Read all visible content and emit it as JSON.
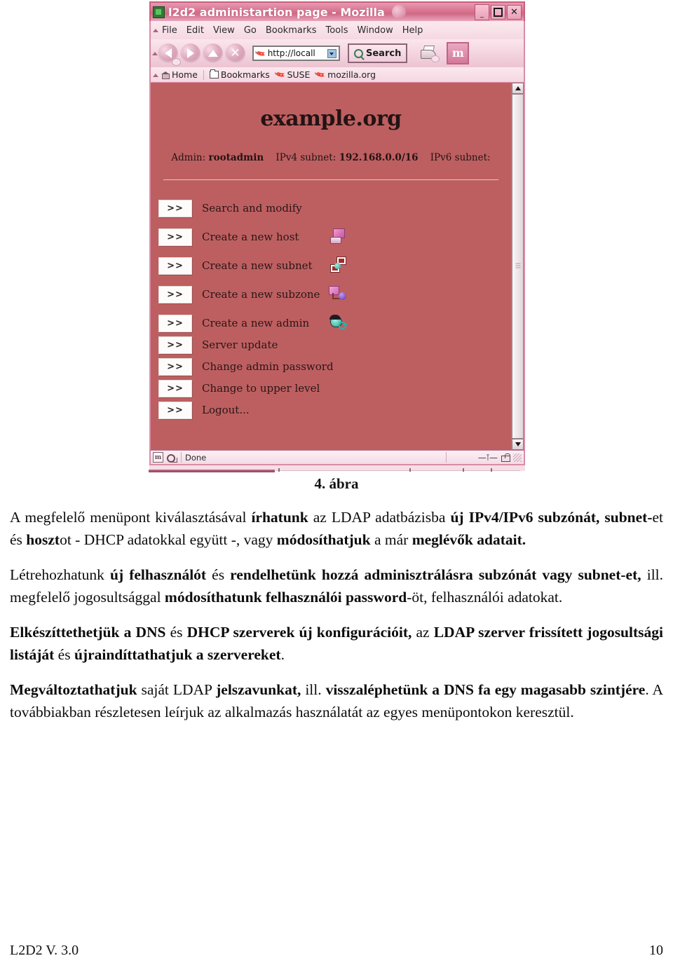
{
  "figure": {
    "browser": {
      "title": "l2d2 administartion page - Mozilla",
      "title_icon": "mozilla-document-icon",
      "throbber": "throbber-icon",
      "window_buttons": [
        {
          "name": "minimize-button",
          "glyph": "_"
        },
        {
          "name": "maximize-button",
          "glyph": "□"
        },
        {
          "name": "close-button",
          "glyph": "✕"
        }
      ],
      "menus": [
        "File",
        "Edit",
        "View",
        "Go",
        "Bookmarks",
        "Tools",
        "Window",
        "Help"
      ],
      "toolbar": {
        "back": "Back",
        "forward": "Forward",
        "reload": "Reload",
        "stop": "Stop",
        "url_value": "http://locall",
        "search_label": "Search",
        "print": "Print",
        "logo": "m"
      },
      "personal_bar": [
        "Home",
        "Bookmarks",
        "SUSE",
        "mozilla.org"
      ],
      "status": {
        "text": "Done",
        "security": "unlocked"
      }
    },
    "page": {
      "site_title": "example.org",
      "meta": {
        "admin_label": "Admin:",
        "admin_value": "rootadmin",
        "ipv4_label": "IPv4 subnet:",
        "ipv4_value": "192.168.0.0/16",
        "ipv6_label": "IPv6 subnet:",
        "ipv6_value": ""
      },
      "menu_items": [
        {
          "button": ">>",
          "label": "Search and modify",
          "icon": "none"
        },
        {
          "button": ">>",
          "label": "Create a new host",
          "icon": "host-computer-icon"
        },
        {
          "button": ">>",
          "label": "Create a new subnet",
          "icon": "subnet-network-icon"
        },
        {
          "button": ">>",
          "label": "Create a new subzone",
          "icon": "subzone-globe-icon"
        },
        {
          "button": ">>",
          "label": "Create a new admin",
          "icon": "admin-user-key-icon"
        },
        {
          "button": ">>",
          "label": "Server update",
          "icon": "none"
        },
        {
          "button": ">>",
          "label": "Change admin password",
          "icon": "none"
        },
        {
          "button": ">>",
          "label": "Change to upper level",
          "icon": "none"
        },
        {
          "button": ">>",
          "label": "Logout...",
          "icon": "none"
        }
      ]
    },
    "caption": "4. ábra",
    "colors": {
      "page_background": "#bd5f60",
      "chrome_pink": "#f4d6e1",
      "titlebar_pink": "#d8738f"
    }
  },
  "body": {
    "p1": {
      "s1": "A megfelelő menüpont kiválasztásával ",
      "b1": "írhatunk",
      "s2": " az LDAP adatbázisba ",
      "b2": "új IPv4/IPv6 subzónát, subnet-",
      "s3": "et és ",
      "b3": "hoszt",
      "s4": "ot - DHCP adatokkal együtt -, vagy ",
      "b4": "módosíthatjuk",
      "s5": " a már ",
      "b5": "meglévők adatait."
    },
    "p2": {
      "s1": "Létrehozhatunk ",
      "b1": "új felhasználót",
      "s2": " és ",
      "b2": "rendelhetünk hozzá adminisztrálásra subzónát vagy subnet-et,",
      "s3": " ill. megfelelő jogosultsággal ",
      "b3": "módosíthatunk felhasználói password",
      "s4": "-öt, felhasználói adatokat."
    },
    "p3": {
      "b1": "Elkészíttethetjük a DNS",
      "s1": " és ",
      "b2": "DHCP szerverek új konfigurációit,",
      "s2": " az ",
      "b3": "LDAP szerver frissített jogosultsági listáját",
      "s3": " és ",
      "b4": "újraindíttathatjuk a szervereket",
      "s4": "."
    },
    "p4": {
      "b1": "Megváltoztathatjuk",
      "s1": " saját LDAP ",
      "b2": "jelszavunkat,",
      "s2": " ill. ",
      "b3": "visszaléphetünk a DNS fa egy magasabb szintjére",
      "s3": ". A továbbiakban részletesen leírjuk az alkalmazás használatát az egyes menüpontokon keresztül."
    }
  },
  "footer": {
    "left": "L2D2 V. 3.0",
    "right": "10"
  }
}
